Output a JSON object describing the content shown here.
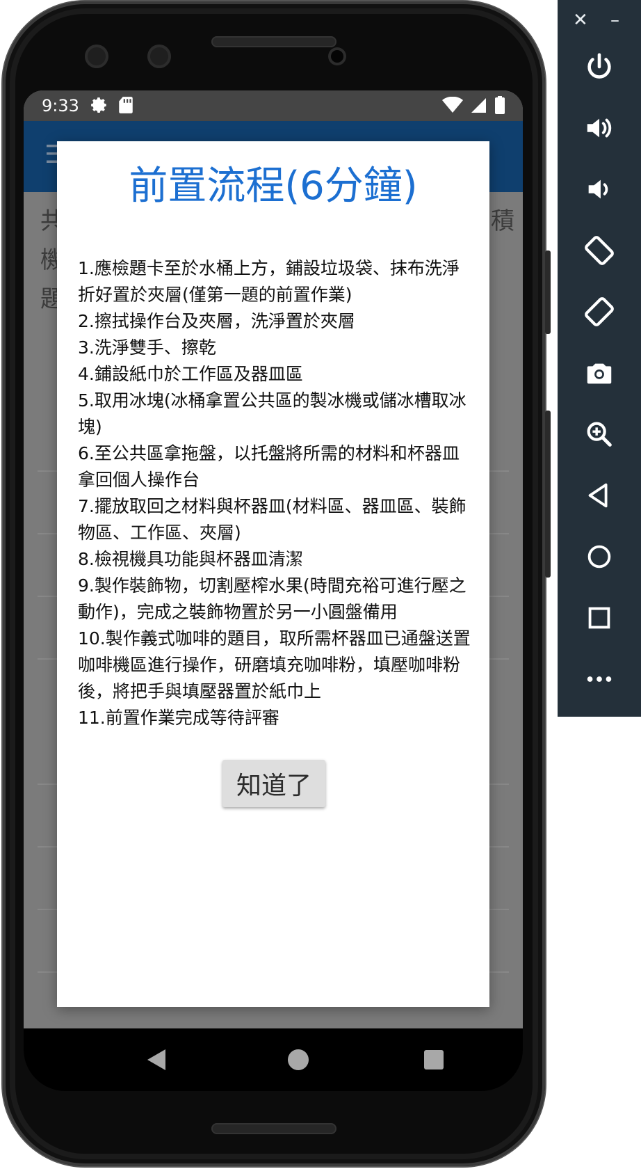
{
  "status_bar": {
    "time": "9:33",
    "icons_left": [
      "gear-icon",
      "sd-card-icon"
    ],
    "icons_right": [
      "wifi-icon",
      "signal-icon",
      "battery-icon"
    ]
  },
  "background": {
    "line1_left": "共",
    "line2_left": "機",
    "line3_left": "題",
    "line1_right": "積"
  },
  "dialog": {
    "title": "前置流程(6分鐘)",
    "steps": [
      "1.應檢題卡至於水桶上方，鋪設垃圾袋、抹布洗淨折好置於夾層(僅第一題的前置作業)",
      "2.擦拭操作台及夾層，洗淨置於夾層",
      "3.洗淨雙手、擦乾",
      "4.鋪設紙巾於工作區及器皿區",
      "5.取用冰塊(冰桶拿置公共區的製冰機或儲冰槽取冰塊)",
      "6.至公共區拿拖盤，以托盤將所需的材料和杯器皿拿回個人操作台",
      "7.擺放取回之材料與杯器皿(材料區、器皿區、裝飾物區、工作區、夾層)",
      "8.檢視機具功能與杯器皿清潔",
      "9.製作裝飾物，切割壓榨水果(時間充裕可進行壓之動作)，完成之裝飾物置於另一小圓盤備用",
      "10.製作義式咖啡的題目，取所需杯器皿已通盤送置咖啡機區進行操作，研磨填充咖啡粉，填壓咖啡粉後，將把手與填壓器置於紙巾上",
      "11.前置作業完成等待評審"
    ],
    "ok_label": "知道了"
  },
  "emulator_panel": {
    "close_label": "✕",
    "minimize_label": "–",
    "buttons": [
      "power-icon",
      "volume-up-icon",
      "volume-down-icon",
      "rotate-left-icon",
      "rotate-right-icon",
      "camera-icon",
      "zoom-icon",
      "back-icon",
      "home-icon",
      "overview-icon",
      "more-icon"
    ],
    "more_label": "•••"
  },
  "colors": {
    "title_blue": "#1c6fd1",
    "appbar": "#0f3f6e",
    "emu_panel": "#24303a"
  }
}
